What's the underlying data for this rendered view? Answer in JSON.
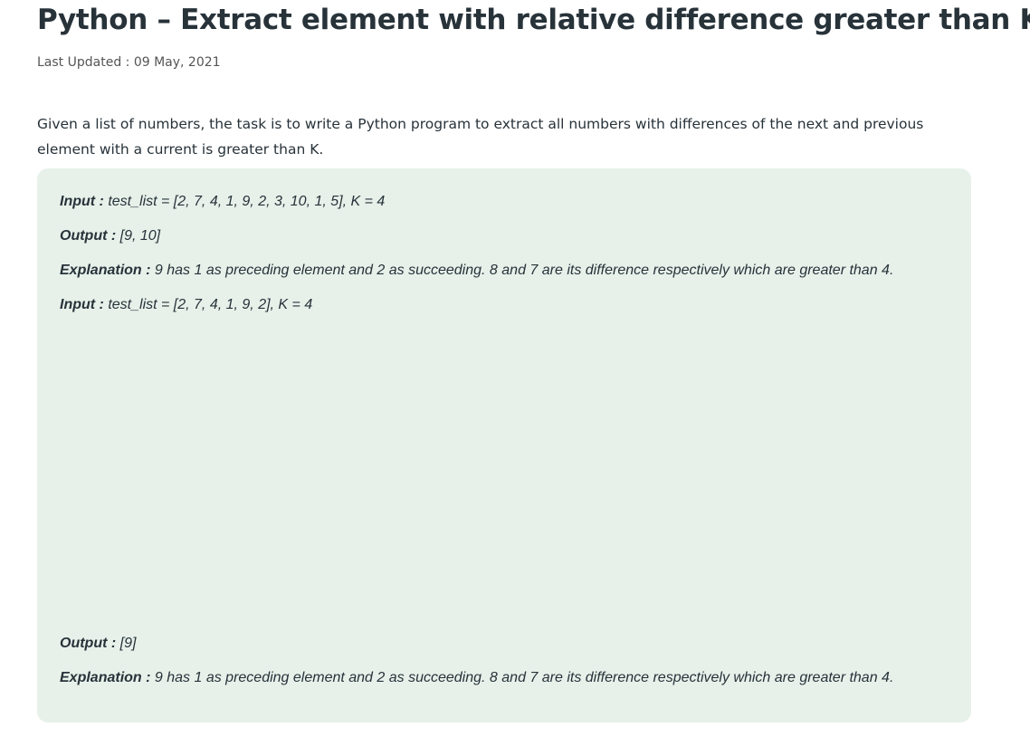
{
  "article": {
    "title": "Python – Extract element with relative difference greater than K",
    "last_updated": "Last Updated : 09 May, 2021",
    "intro": "Given a list of numbers, the task is to write a Python program to extract all numbers with differences of the next and previous element with a current is greater than K."
  },
  "example": {
    "lines": [
      {
        "label": "Input :",
        "text": " test_list = [2, 7, 4, 1, 9, 2, 3, 10, 1, 5], K = 4"
      },
      {
        "label": "Output :",
        "text": " [9, 10]"
      },
      {
        "label": "Explanation :",
        "text": " 9 has 1 as preceding element and 2 as succeeding. 8 and 7 are its difference respectively which are greater than 4."
      },
      {
        "label": "Input :",
        "text": " test_list = [2, 7, 4, 1, 9, 2], K = 4"
      },
      {
        "label": "Output :",
        "text": " [9]"
      },
      {
        "label": "Explanation :",
        "text": " 9 has 1 as preceding element and 2 as succeeding. 8 and 7 are its difference respectively which are greater than 4."
      }
    ]
  }
}
